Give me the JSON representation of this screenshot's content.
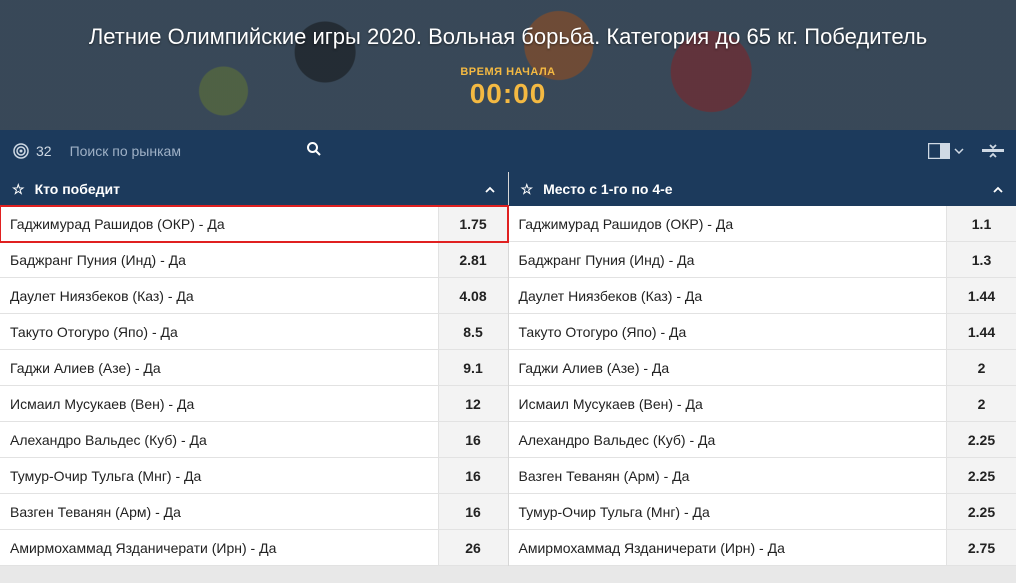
{
  "hero": {
    "title": "Летние Олимпийские игры 2020. Вольная борьба. Категория до 65 кг. Победитель",
    "start_label": "ВРЕМЯ НАЧАЛА",
    "start_time": "00:00"
  },
  "toolbar": {
    "market_count": "32",
    "search_placeholder": "Поиск по рынкам"
  },
  "markets": [
    {
      "title": "Кто победит",
      "rows": [
        {
          "name": "Гаджимурад Рашидов (ОКР) - Да",
          "odds": "1.75",
          "highlight": true
        },
        {
          "name": "Баджранг Пуния (Инд) - Да",
          "odds": "2.81"
        },
        {
          "name": "Даулет Ниязбеков (Каз) - Да",
          "odds": "4.08"
        },
        {
          "name": "Такуто Отогуро (Япо) - Да",
          "odds": "8.5"
        },
        {
          "name": "Гаджи Алиев (Азе) - Да",
          "odds": "9.1"
        },
        {
          "name": "Исмаил Мусукаев (Вен) - Да",
          "odds": "12"
        },
        {
          "name": "Алехандро Вальдес (Куб) - Да",
          "odds": "16"
        },
        {
          "name": "Тумур-Очир Тульга (Мнг) - Да",
          "odds": "16"
        },
        {
          "name": "Вазген Теванян (Арм) - Да",
          "odds": "16"
        },
        {
          "name": "Амирмохаммад Язданичерати (Ирн) - Да",
          "odds": "26"
        }
      ]
    },
    {
      "title": "Место с 1-го по 4-е",
      "rows": [
        {
          "name": "Гаджимурад Рашидов (ОКР) - Да",
          "odds": "1.1"
        },
        {
          "name": "Баджранг Пуния (Инд) - Да",
          "odds": "1.3"
        },
        {
          "name": "Даулет Ниязбеков (Каз) - Да",
          "odds": "1.44"
        },
        {
          "name": "Такуто Отогуро (Япо) - Да",
          "odds": "1.44"
        },
        {
          "name": "Гаджи Алиев (Азе) - Да",
          "odds": "2"
        },
        {
          "name": "Исмаил Мусукаев (Вен) - Да",
          "odds": "2"
        },
        {
          "name": "Алехандро Вальдес (Куб) - Да",
          "odds": "2.25"
        },
        {
          "name": "Вазген Теванян (Арм) - Да",
          "odds": "2.25"
        },
        {
          "name": "Тумур-Очир Тульга (Мнг) - Да",
          "odds": "2.25"
        },
        {
          "name": "Амирмохаммад Язданичерати (Ирн) - Да",
          "odds": "2.75"
        }
      ]
    }
  ]
}
